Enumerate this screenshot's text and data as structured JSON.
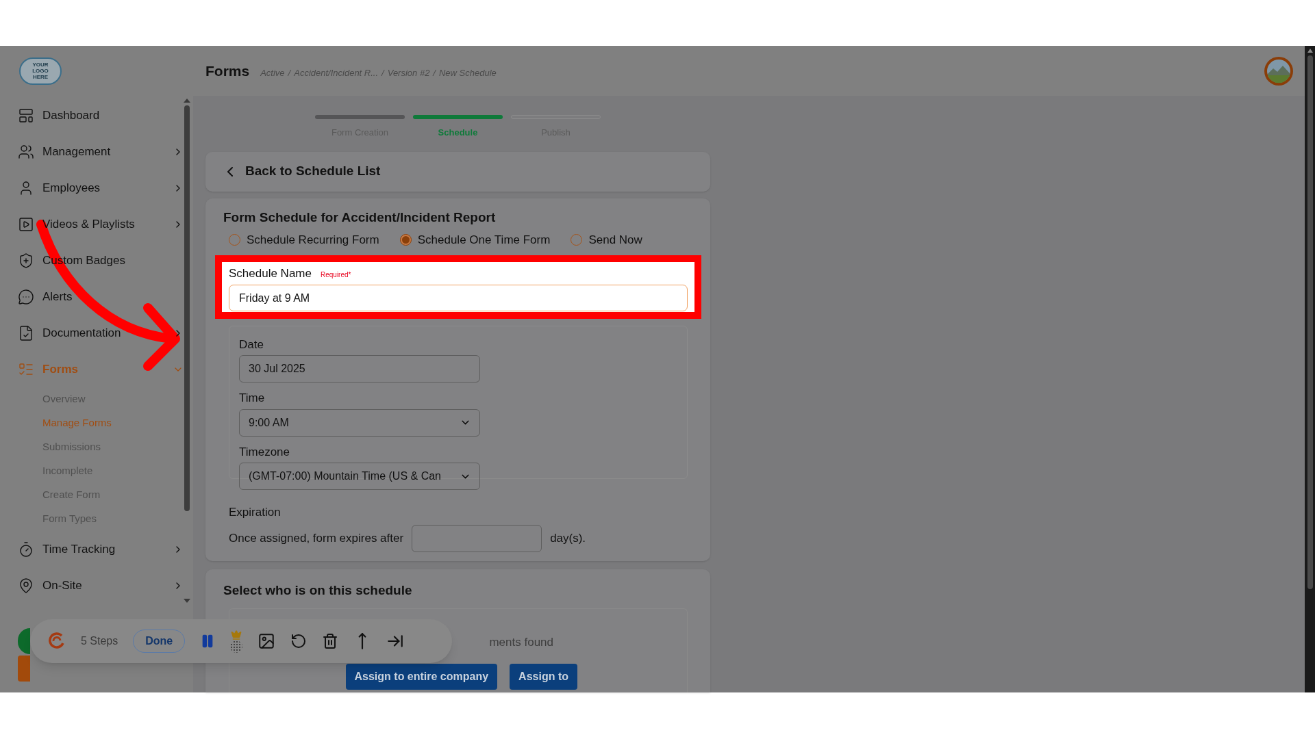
{
  "logo": {
    "text": "YOUR LOGO HERE"
  },
  "page_title": "Forms",
  "breadcrumb": {
    "separator": "/",
    "items": [
      "Active",
      "Accident/Incident R...",
      "Version #2",
      "New Schedule"
    ]
  },
  "sidebar": {
    "items": [
      {
        "label": "Dashboard",
        "kind": "link",
        "selected": false
      },
      {
        "label": "Management",
        "kind": "group",
        "selected": false,
        "expanded": false
      },
      {
        "label": "Employees",
        "kind": "group",
        "selected": false,
        "expanded": false
      },
      {
        "label": "Videos & Playlists",
        "kind": "group",
        "selected": false,
        "expanded": false
      },
      {
        "label": "Custom Badges",
        "kind": "link",
        "selected": false
      },
      {
        "label": "Alerts",
        "kind": "link",
        "selected": false
      },
      {
        "label": "Documentation",
        "kind": "group",
        "selected": false,
        "expanded": false
      },
      {
        "label": "Forms",
        "kind": "group",
        "selected": true,
        "expanded": true,
        "children": [
          {
            "label": "Overview",
            "selected": false
          },
          {
            "label": "Manage Forms",
            "selected": true
          },
          {
            "label": "Submissions",
            "selected": false
          },
          {
            "label": "Incomplete",
            "selected": false
          },
          {
            "label": "Create Form",
            "selected": false
          },
          {
            "label": "Form Types",
            "selected": false
          }
        ]
      },
      {
        "label": "Time Tracking",
        "kind": "group",
        "selected": false,
        "expanded": false
      },
      {
        "label": "On-Site",
        "kind": "group",
        "selected": false,
        "expanded": false
      }
    ]
  },
  "stepper": [
    {
      "label": "Form Creation",
      "completed": true,
      "selected": false
    },
    {
      "label": "Schedule",
      "completed": false,
      "selected": true
    },
    {
      "label": "Publish",
      "completed": false,
      "selected": false
    }
  ],
  "back_link": "Back to Schedule List",
  "form": {
    "title": "Form Schedule for Accident/Incident Report",
    "schedule_types": [
      {
        "label": "Schedule Recurring Form",
        "selected": false
      },
      {
        "label": "Schedule One Time Form",
        "selected": true
      },
      {
        "label": "Send Now",
        "selected": false
      }
    ],
    "schedule_name": {
      "label": "Schedule Name",
      "required": "Required*",
      "value": "Friday at 9 AM"
    },
    "date": {
      "label": "Date",
      "value": "30 Jul 2025"
    },
    "time": {
      "label": "Time",
      "value": "9:00 AM"
    },
    "timezone": {
      "label": "Timezone",
      "value": "(GMT-07:00) Mountain Time (US & Can"
    },
    "expiration": {
      "label": "Expiration",
      "text": "Once assigned, form expires after",
      "suffix": "day(s)."
    }
  },
  "assignment": {
    "title": "Select who is on this schedule",
    "status": "ments found",
    "buttons": [
      "Assign to entire company",
      "Assign to"
    ]
  },
  "recorder": {
    "steps": "5 Steps",
    "done": "Done"
  }
}
